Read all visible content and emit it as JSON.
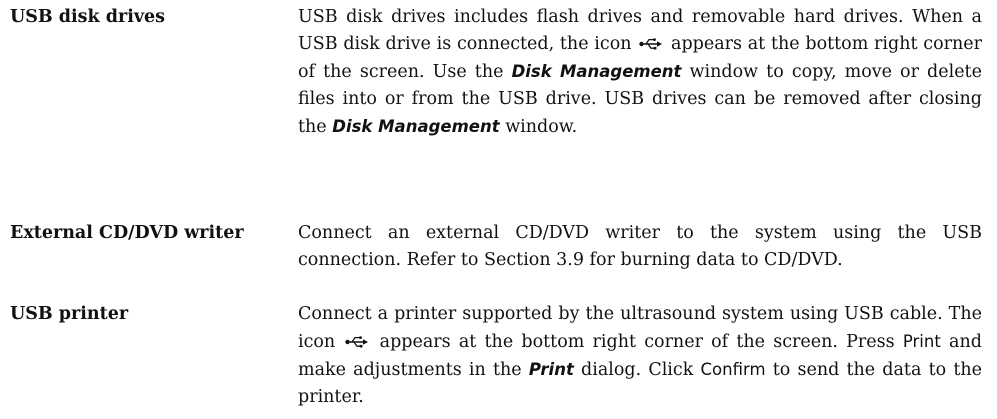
{
  "entries": [
    {
      "term": "USB disk drives",
      "def": {
        "p1": "USB disk drives includes flash drives and removable hard drives. When a USB disk drive is connected, the icon",
        "p2": "appears at the bottom right corner of the screen. Use the",
        "ui1": "Disk Management",
        "p3": "window to copy, move or delete files into or from the USB drive. USB drives can be removed after closing the",
        "ui2": "Disk Management",
        "p4": "window."
      }
    },
    {
      "term": "External CD/DVD writer",
      "def": {
        "p1": "Connect an external CD/DVD writer to the system using the USB connection. Refer to Section 3.9 for burning data to CD/DVD."
      }
    },
    {
      "term": "USB printer",
      "def": {
        "p1": "Connect a printer supported by the ultrasound system using USB cable.  The icon",
        "p2": "appears at the bottom right corner of the screen.  Press",
        "key1": "Print",
        "p3": "and make adjustments in the",
        "ui1": "Print",
        "p4": "dialog. Click",
        "key2": "Confirm",
        "p5": "to send the data to the printer."
      }
    }
  ],
  "icons": {
    "usb": "usb-icon"
  }
}
